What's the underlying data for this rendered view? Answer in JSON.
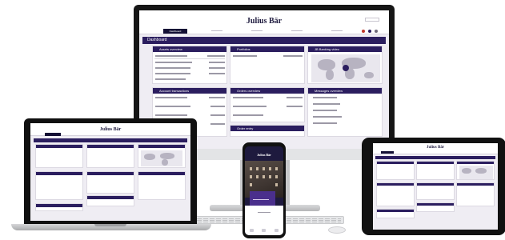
{
  "brand": "Julius Bär",
  "nav": {
    "tabs": [
      "Dashboard"
    ]
  },
  "dashboard": {
    "title": "Dashboard",
    "widgets": [
      "Assets overview",
      "Portfolios",
      "JB Banking video",
      "Account transactions",
      "Orders overview",
      "Messages overview",
      "Order entry"
    ]
  },
  "colors": {
    "header": "#2b1e5f",
    "brand_navy": "#1e1a3e",
    "accent_purple": "#4a2f8c"
  },
  "icons": [
    "play-icon",
    "notification-icon",
    "user-icon",
    "home-icon"
  ]
}
